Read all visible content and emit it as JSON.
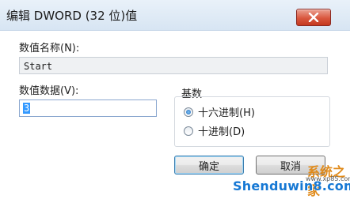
{
  "window": {
    "title": "编辑 DWORD (32 位)值",
    "close_icon": "close-x-icon"
  },
  "value_name": {
    "label": "数值名称(N):",
    "value": "Start"
  },
  "value_data": {
    "label": "数值数据(V):",
    "value": "3"
  },
  "base": {
    "label": "基数",
    "options": [
      {
        "label": "十六进制(H)",
        "checked": true
      },
      {
        "label": "十进制(D)",
        "checked": false
      }
    ]
  },
  "buttons": {
    "ok": "确定",
    "cancel": "取消"
  },
  "watermark": {
    "text": "Shenduwin8.com",
    "cn": "系统之家",
    "url": "www.xp85.com"
  },
  "colors": {
    "close_button": "#d9583f",
    "selection": "#3399ff",
    "watermark_blue": "#1678d4"
  }
}
